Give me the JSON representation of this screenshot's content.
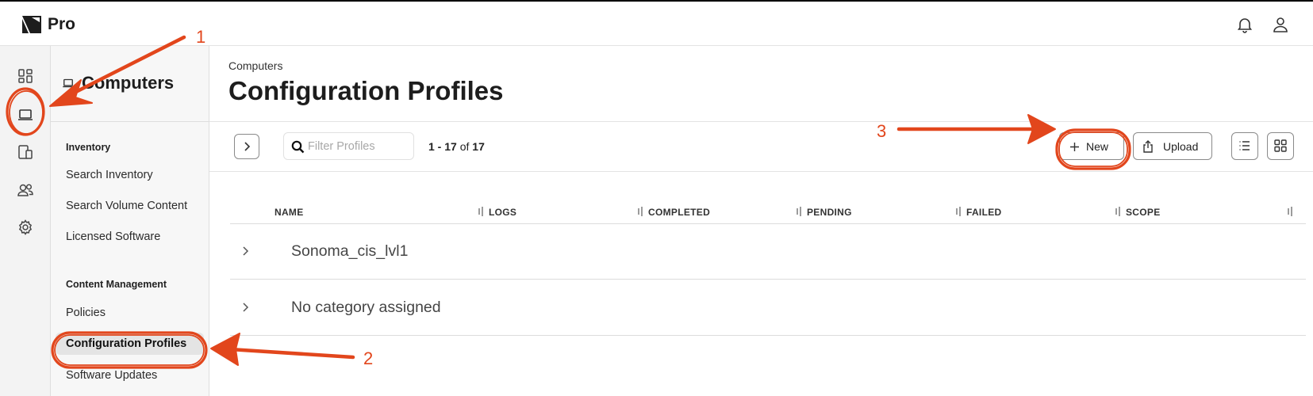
{
  "app": {
    "brand": "Pro",
    "colors": {
      "accent_annotation": "#e2461c",
      "rail_bg": "#f3f3f3",
      "sidenav_bg": "#f7f7f7"
    }
  },
  "header": {
    "icons": [
      "bell-icon",
      "user-icon"
    ]
  },
  "rail": {
    "items": [
      {
        "icon": "dashboard-icon"
      },
      {
        "icon": "laptop-icon",
        "active": true
      },
      {
        "icon": "mobile-devices-icon"
      },
      {
        "icon": "users-icon"
      },
      {
        "icon": "settings-gear-icon"
      }
    ]
  },
  "sidebar": {
    "title": "Computers",
    "sections": [
      {
        "title": "Inventory",
        "items": [
          "Search Inventory",
          "Search Volume Content",
          "Licensed Software"
        ]
      },
      {
        "title": "Content Management",
        "items": [
          "Policies",
          "Configuration Profiles",
          "Software Updates"
        ]
      }
    ],
    "active_item": "Configuration Profiles"
  },
  "main": {
    "breadcrumb": "Computers",
    "title": "Configuration Profiles",
    "toolbar": {
      "filter_placeholder": "Filter Profiles",
      "count_range": "1 - 17",
      "count_of": "of",
      "count_total": "17",
      "new_label": "New",
      "upload_label": "Upload"
    },
    "table": {
      "columns": [
        "NAME",
        "LOGS",
        "COMPLETED",
        "PENDING",
        "FAILED",
        "SCOPE"
      ],
      "groups": [
        "Sonoma_cis_lvl1",
        "No category assigned"
      ]
    }
  },
  "annotations": {
    "labels": [
      "1",
      "2",
      "3"
    ]
  }
}
